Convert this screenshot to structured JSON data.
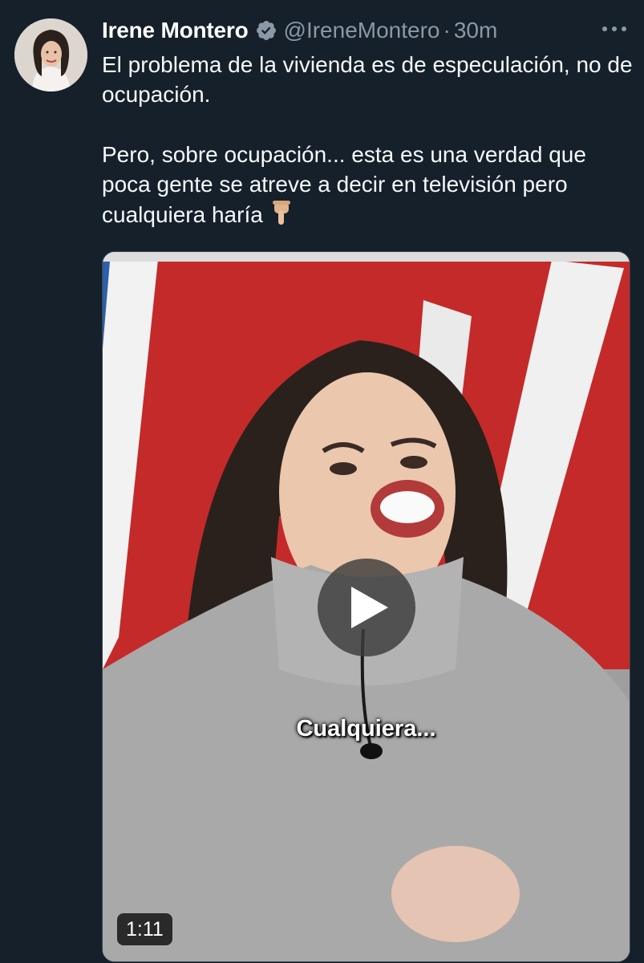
{
  "tweet": {
    "author_name": "Irene Montero",
    "handle": "@IreneMontero",
    "separator": "·",
    "time": "30m",
    "paragraph_1": "El problema de la vivienda es de especulación, no de ocupación.",
    "paragraph_2": "Pero, sobre ocupación... esta es una verdad que poca gente se atreve a decir en televisión pero cualquiera haría"
  },
  "media": {
    "type": "video",
    "caption": "Cualquiera...",
    "duration": "1:11"
  },
  "icons": {
    "verified": "verified-badge-icon",
    "more": "more-options-icon",
    "emoji": "backhand-index-pointing-down-emoji",
    "play": "play-icon"
  },
  "colors": {
    "background": "#15202b",
    "primary_text": "#f7f9f9",
    "secondary_text": "#8b98a5",
    "verified": "#8b98a5"
  }
}
